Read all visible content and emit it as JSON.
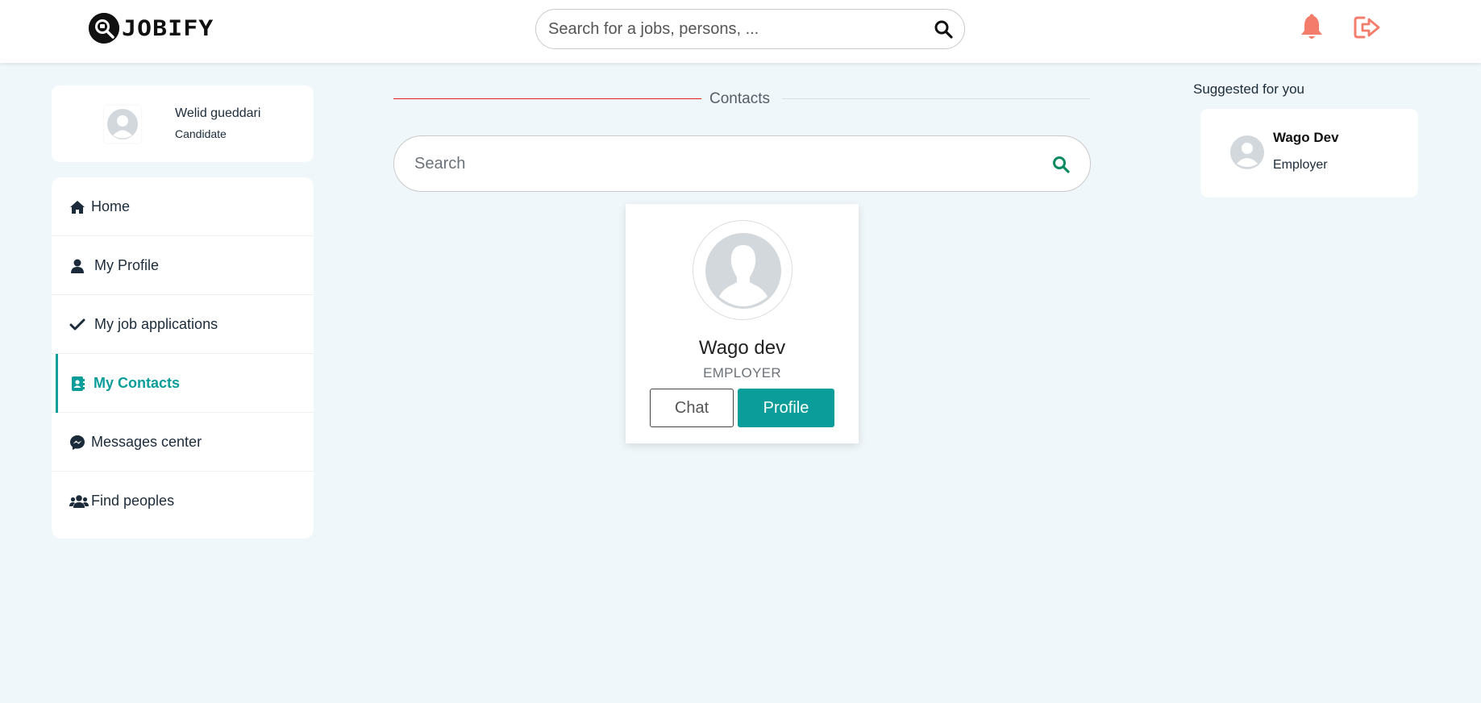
{
  "header": {
    "logo_text": "JOBIFY",
    "search_placeholder": "Search for a jobs, persons, ...",
    "accent_color": "#f47c6a"
  },
  "user": {
    "name": "Welid gueddari",
    "role": "Candidate"
  },
  "sidebar": {
    "items": [
      {
        "label": "Home",
        "icon": "home-icon"
      },
      {
        "label": "My Profile",
        "icon": "user-icon"
      },
      {
        "label": "My job applications",
        "icon": "check-icon"
      },
      {
        "label": "My Contacts",
        "icon": "address-book-icon",
        "active": true
      },
      {
        "label": "Messages center",
        "icon": "messenger-icon"
      },
      {
        "label": "Find peoples",
        "icon": "users-icon"
      }
    ],
    "active_color": "#0a9d9a"
  },
  "main": {
    "section_title": "Contacts",
    "search_placeholder": "Search",
    "contacts": [
      {
        "name": "Wago dev",
        "role": "EMPLOYER",
        "chat_label": "Chat",
        "profile_label": "Profile"
      }
    ]
  },
  "suggestions": {
    "title": "Suggested for you",
    "items": [
      {
        "name": "Wago Dev",
        "role": "Employer"
      }
    ]
  }
}
